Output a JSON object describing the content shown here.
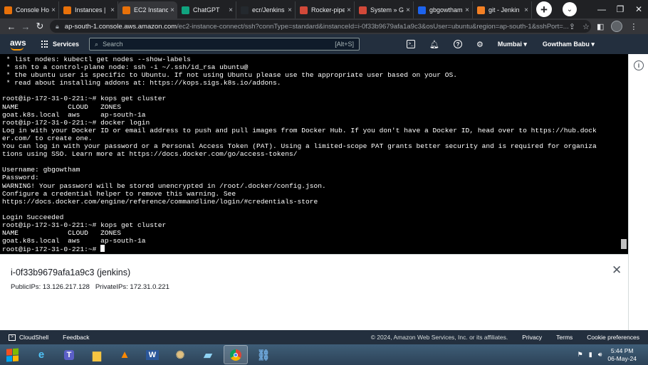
{
  "browser": {
    "tabs": [
      {
        "label": "Console Ho",
        "color": "#e8710a",
        "active": false
      },
      {
        "label": "Instances | ",
        "color": "#e8710a",
        "active": false
      },
      {
        "label": "EC2 Instanc",
        "color": "#e8710a",
        "active": true
      },
      {
        "label": "ChatGPT",
        "color": "#10a37f",
        "active": false
      },
      {
        "label": "ecr/Jenkins",
        "color": "#24292e",
        "active": false
      },
      {
        "label": "Rocker-pipe",
        "color": "#d24939",
        "active": false
      },
      {
        "label": "System » Gi",
        "color": "#d24939",
        "active": false
      },
      {
        "label": "gbgowtham",
        "color": "#1d63ed",
        "active": false
      },
      {
        "label": "git - Jenkin",
        "color": "#f48024",
        "active": false
      }
    ],
    "new_tab": "+",
    "url_host": "ap-south-1.console.aws.amazon.com",
    "url_path": "/ec2-instance-connect/ssh?connType=standard&instanceId=i-0f33b9679afa1a9c3&osUser=ubuntu&region=ap-south-1&sshPort=..."
  },
  "aws": {
    "logo": "aws",
    "services_label": "Services",
    "search_placeholder": "Search",
    "search_shortcut": "[Alt+S]",
    "region": "Mumbai ▾",
    "user": "Gowtham Babu ▾"
  },
  "terminal": {
    "lines": [
      " * list nodes: kubectl get nodes --show-labels",
      " * ssh to a control-plane node: ssh -i ~/.ssh/id_rsa ubuntu@",
      " * the ubuntu user is specific to Ubuntu. If not using Ubuntu please use the appropriate user based on your OS.",
      " * read about installing addons at: https://kops.sigs.k8s.io/addons.",
      "",
      "root@ip-172-31-0-221:~# kops get cluster",
      "NAME            CLOUD   ZONES",
      "goat.k8s.local  aws     ap-south-1a",
      "root@ip-172-31-0-221:~# docker login",
      "Log in with your Docker ID or email address to push and pull images from Docker Hub. If you don't have a Docker ID, head over to https://hub.dock",
      "er.com/ to create one.",
      "You can log in with your password or a Personal Access Token (PAT). Using a limited-scope PAT grants better security and is required for organiza",
      "tions using SSO. Learn more at https://docs.docker.com/go/access-tokens/",
      "",
      "Username: gbgowtham",
      "Password:",
      "WARNING! Your password will be stored unencrypted in /root/.docker/config.json.",
      "Configure a credential helper to remove this warning. See",
      "https://docs.docker.com/engine/reference/commandline/login/#credentials-store",
      "",
      "Login Succeeded",
      "root@ip-172-31-0-221:~# kops get cluster",
      "NAME            CLOUD   ZONES",
      "goat.k8s.local  aws     ap-south-1a"
    ],
    "prompt": "root@ip-172-31-0-221:~# "
  },
  "instance": {
    "title": "i-0f33b9679afa1a9c3 (jenkins)",
    "ips": "PublicIPs: 13.126.217.128   PrivateIPs: 172.31.0.221"
  },
  "footer": {
    "cloudshell": "CloudShell",
    "feedback": "Feedback",
    "copyright": "© 2024, Amazon Web Services, Inc. or its affiliates.",
    "links": [
      "Privacy",
      "Terms",
      "Cookie preferences"
    ]
  },
  "taskbar": {
    "time": "5:44 PM",
    "date": "06-May-24"
  }
}
